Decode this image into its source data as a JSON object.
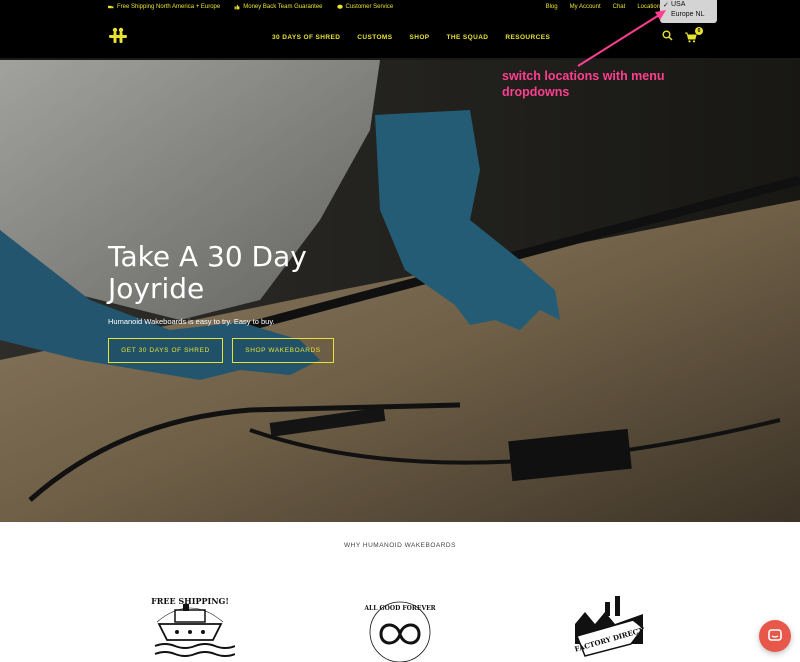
{
  "topbar": {
    "left_items": [
      {
        "icon": "truck-icon",
        "label": "Free Shipping North America + Europe"
      },
      {
        "icon": "thumbs-up-icon",
        "label": "Money Back Team Guarantee"
      },
      {
        "icon": "chat-bubble-icon",
        "label": "Customer Service"
      }
    ],
    "right_links": [
      "Blog",
      "My Account",
      "Chat",
      "Location"
    ]
  },
  "location_dropdown": {
    "options": [
      "USA",
      "Europe NL"
    ],
    "selected": "USA"
  },
  "nav": {
    "items": [
      "30 DAYS OF SHRED",
      "CUSTOMS",
      "SHOP",
      "THE SQUAD",
      "RESOURCES"
    ],
    "cart_count": "0"
  },
  "hero": {
    "title": "Take A 30 Day Joyride",
    "subtitle": "Humanoid Wakeboards is easy to try. Easy to buy.",
    "primary_button": "GET 30 DAYS OF SHRED",
    "secondary_button": "SHOP WAKEBOARDS"
  },
  "annotation": "switch locations with menu dropdowns",
  "section": {
    "title": "WHY HUMANOID WAKEBOARDS",
    "features": [
      {
        "icon": "free-shipping-boat-icon",
        "text": "FREE SHIPPING!"
      },
      {
        "icon": "all-good-forever-infinity-icon",
        "text": "ALL GOOD FOREVER"
      },
      {
        "icon": "factory-direct-icon",
        "text": "FACTORY DIRECT"
      }
    ]
  },
  "colors": {
    "accent": "#e8e233",
    "annotation": "#ff3f8f",
    "chat": "#e8584a"
  }
}
